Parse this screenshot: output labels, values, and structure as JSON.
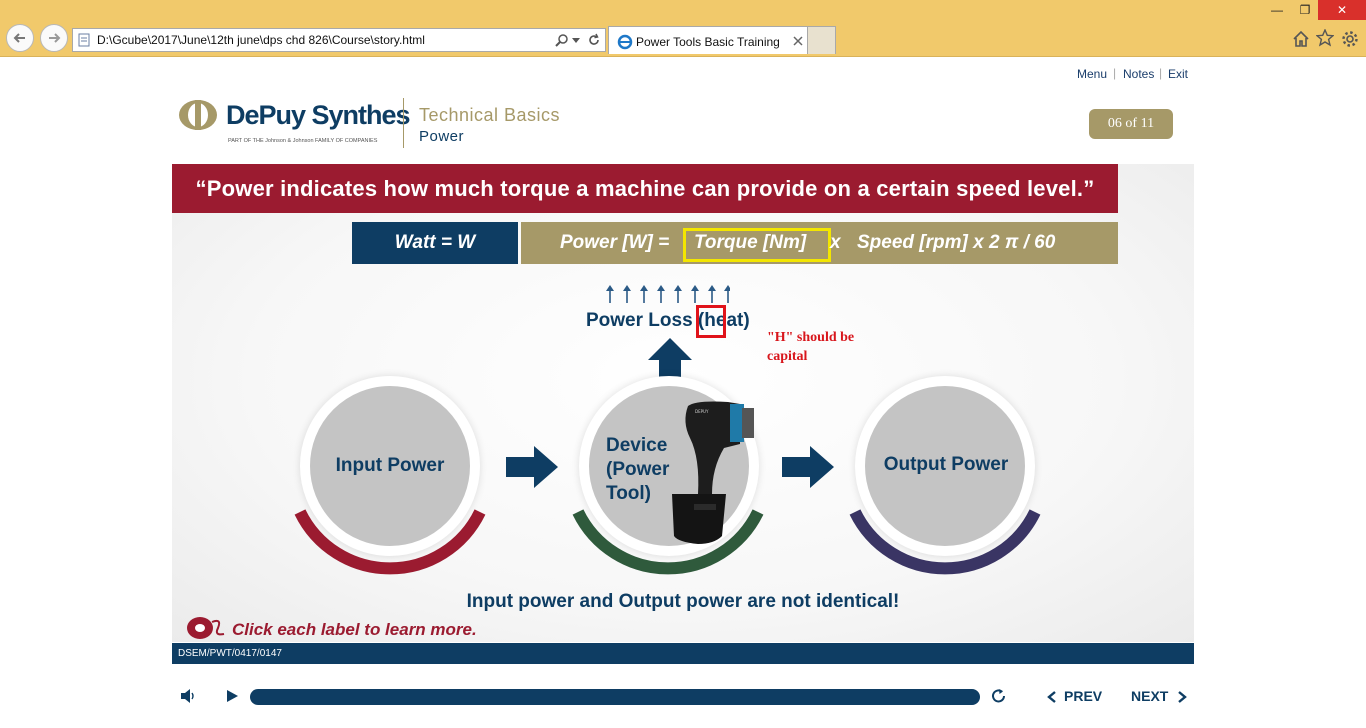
{
  "browser": {
    "address": "D:\\Gcube\\2017\\June\\12th june\\dps chd 826\\Course\\story.html",
    "tab_title": "Power Tools Basic Training",
    "minimize": "—",
    "restore": "❐",
    "close": "✕",
    "icons": [
      "back-icon",
      "forward-icon",
      "search-icon",
      "dropdown-icon",
      "refresh-icon",
      "ie-icon",
      "close-tab-icon",
      "home-icon",
      "star-icon",
      "gear-icon"
    ]
  },
  "top_nav": {
    "menu": "Menu",
    "notes": "Notes",
    "exit": "Exit",
    "sep": "|"
  },
  "brand": {
    "name": "DePuy Synthes",
    "tagline": "PART OF THE Johnson & Johnson FAMILY OF COMPANIES",
    "course": "Technical Basics",
    "section": "Power"
  },
  "counter": "06 of 11",
  "slide": {
    "quote": "“Power indicates how much torque a machine can provide on a certain speed level.”",
    "watt": "Watt = W",
    "formula_power": "Power [W]  =",
    "formula_torque": "Torque [Nm]",
    "formula_x": "x",
    "formula_speed": "Speed [rpm]   x  2 π / 60",
    "power_loss_pre": "Power Loss (",
    "power_loss_he": "he",
    "power_loss_post": "at)",
    "note": "\"H\" should be capital",
    "input_label": "Input Power",
    "device_label_1": "Device",
    "device_label_2": "(Power",
    "device_label_3": "Tool)",
    "output_label": "Output Power",
    "not_identical": "Input power and Output power are not identical!",
    "click_each": "Click each label to learn more.",
    "code": "DSEM/PWT/0417/0147"
  },
  "colors": {
    "chrome": "#f1c96b",
    "navy": "#0e3d63",
    "crimson": "#9b1b30",
    "gold": "#a69968",
    "green": "#2f5a3c",
    "purple": "#3a3564",
    "highlight_yellow": "#f3e600",
    "annotation_red": "#e0131a"
  },
  "player": {
    "prev": "PREV",
    "next": "NEXT",
    "progress": 1.0
  }
}
